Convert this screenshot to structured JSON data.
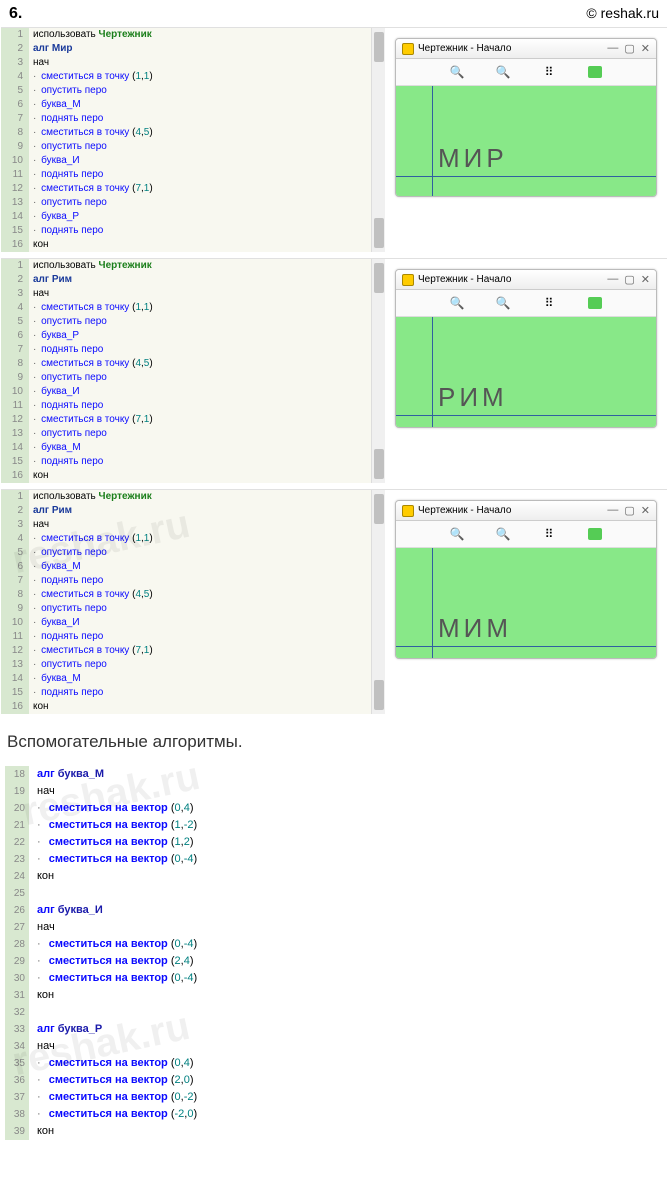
{
  "header": {
    "num": "6.",
    "site": "© reshak.ru"
  },
  "progs": [
    {
      "lines": [
        {
          "n": "1",
          "p": [
            {
              "t": "использовать ",
              "c": ""
            },
            {
              "t": "Чертежник",
              "c": "kw-lib"
            }
          ]
        },
        {
          "n": "2",
          "p": [
            {
              "t": "алг ",
              "c": "kw-alg"
            },
            {
              "t": "Мир",
              "c": "kw-nm"
            }
          ]
        },
        {
          "n": "3",
          "p": [
            {
              "t": "нач",
              "c": "kw-s"
            }
          ]
        },
        {
          "n": "4",
          "d": true,
          "p": [
            {
              "t": "сместиться в точку ",
              "c": "kw-cmd"
            },
            {
              "t": "(",
              "c": ""
            },
            {
              "t": "1",
              "c": "num"
            },
            {
              "t": ",",
              "c": ""
            },
            {
              "t": "1",
              "c": "num"
            },
            {
              "t": ")",
              "c": ""
            }
          ]
        },
        {
          "n": "5",
          "d": true,
          "p": [
            {
              "t": "опустить перо",
              "c": "kw-cmd"
            }
          ]
        },
        {
          "n": "6",
          "d": true,
          "p": [
            {
              "t": "буква_М",
              "c": "kw-cmd"
            }
          ]
        },
        {
          "n": "7",
          "d": true,
          "p": [
            {
              "t": "поднять перо",
              "c": "kw-cmd"
            }
          ]
        },
        {
          "n": "8",
          "d": true,
          "p": [
            {
              "t": "сместиться в точку ",
              "c": "kw-cmd"
            },
            {
              "t": "(",
              "c": ""
            },
            {
              "t": "4",
              "c": "num"
            },
            {
              "t": ",",
              "c": ""
            },
            {
              "t": "5",
              "c": "num"
            },
            {
              "t": ")",
              "c": ""
            }
          ]
        },
        {
          "n": "9",
          "d": true,
          "p": [
            {
              "t": "опустить перо",
              "c": "kw-cmd"
            }
          ]
        },
        {
          "n": "10",
          "d": true,
          "p": [
            {
              "t": "буква_И",
              "c": "kw-cmd"
            }
          ]
        },
        {
          "n": "11",
          "d": true,
          "p": [
            {
              "t": "поднять перо",
              "c": "kw-cmd"
            }
          ]
        },
        {
          "n": "12",
          "d": true,
          "p": [
            {
              "t": "сместиться в точку ",
              "c": "kw-cmd"
            },
            {
              "t": "(",
              "c": ""
            },
            {
              "t": "7",
              "c": "num"
            },
            {
              "t": ",",
              "c": ""
            },
            {
              "t": "1",
              "c": "num"
            },
            {
              "t": ")",
              "c": ""
            }
          ]
        },
        {
          "n": "13",
          "d": true,
          "p": [
            {
              "t": "опустить перо",
              "c": "kw-cmd"
            }
          ]
        },
        {
          "n": "14",
          "d": true,
          "p": [
            {
              "t": "буква_Р",
              "c": "kw-cmd"
            }
          ]
        },
        {
          "n": "15",
          "d": true,
          "p": [
            {
              "t": "поднять перо",
              "c": "kw-cmd"
            }
          ]
        },
        {
          "n": "16",
          "p": [
            {
              "t": "кон",
              "c": "kw-s"
            }
          ]
        }
      ],
      "out": {
        "title": "Чертежник - Начало",
        "word": "МИР",
        "ax_h": 90,
        "ax_v": 36
      }
    },
    {
      "lines": [
        {
          "n": "1",
          "p": [
            {
              "t": "использовать ",
              "c": ""
            },
            {
              "t": "Чертежник",
              "c": "kw-lib"
            }
          ]
        },
        {
          "n": "2",
          "p": [
            {
              "t": "алг ",
              "c": "kw-alg"
            },
            {
              "t": "Рим",
              "c": "kw-nm"
            }
          ]
        },
        {
          "n": "3",
          "p": [
            {
              "t": "нач",
              "c": "kw-s"
            }
          ]
        },
        {
          "n": "4",
          "d": true,
          "p": [
            {
              "t": "сместиться в точку ",
              "c": "kw-cmd"
            },
            {
              "t": "(",
              "c": ""
            },
            {
              "t": "1",
              "c": "num"
            },
            {
              "t": ",",
              "c": ""
            },
            {
              "t": "1",
              "c": "num"
            },
            {
              "t": ")",
              "c": ""
            }
          ]
        },
        {
          "n": "5",
          "d": true,
          "p": [
            {
              "t": "опустить перо",
              "c": "kw-cmd"
            }
          ]
        },
        {
          "n": "6",
          "d": true,
          "p": [
            {
              "t": "буква_Р",
              "c": "kw-cmd"
            }
          ]
        },
        {
          "n": "7",
          "d": true,
          "p": [
            {
              "t": "поднять перо",
              "c": "kw-cmd"
            }
          ]
        },
        {
          "n": "8",
          "d": true,
          "p": [
            {
              "t": "сместиться в точку ",
              "c": "kw-cmd"
            },
            {
              "t": "(",
              "c": ""
            },
            {
              "t": "4",
              "c": "num"
            },
            {
              "t": ",",
              "c": ""
            },
            {
              "t": "5",
              "c": "num"
            },
            {
              "t": ")",
              "c": ""
            }
          ]
        },
        {
          "n": "9",
          "d": true,
          "p": [
            {
              "t": "опустить перо",
              "c": "kw-cmd"
            }
          ]
        },
        {
          "n": "10",
          "d": true,
          "p": [
            {
              "t": "буква_И",
              "c": "kw-cmd"
            }
          ]
        },
        {
          "n": "11",
          "d": true,
          "p": [
            {
              "t": "поднять перо",
              "c": "kw-cmd"
            }
          ]
        },
        {
          "n": "12",
          "d": true,
          "p": [
            {
              "t": "сместиться в точку ",
              "c": "kw-cmd"
            },
            {
              "t": "(",
              "c": ""
            },
            {
              "t": "7",
              "c": "num"
            },
            {
              "t": ",",
              "c": ""
            },
            {
              "t": "1",
              "c": "num"
            },
            {
              "t": ")",
              "c": ""
            }
          ]
        },
        {
          "n": "13",
          "d": true,
          "p": [
            {
              "t": "опустить перо",
              "c": "kw-cmd"
            }
          ]
        },
        {
          "n": "14",
          "d": true,
          "p": [
            {
              "t": "буква_М",
              "c": "kw-cmd"
            }
          ]
        },
        {
          "n": "15",
          "d": true,
          "p": [
            {
              "t": "поднять перо",
              "c": "kw-cmd"
            }
          ]
        },
        {
          "n": "16",
          "p": [
            {
              "t": "кон",
              "c": "kw-s"
            }
          ]
        }
      ],
      "out": {
        "title": "Чертежник - Начало",
        "word": "РИМ",
        "ax_h": 98,
        "ax_v": 36
      }
    },
    {
      "lines": [
        {
          "n": "1",
          "p": [
            {
              "t": "использовать ",
              "c": ""
            },
            {
              "t": "Чертежник",
              "c": "kw-lib"
            }
          ]
        },
        {
          "n": "2",
          "p": [
            {
              "t": "алг ",
              "c": "kw-alg"
            },
            {
              "t": "Рим",
              "c": "kw-nm"
            }
          ]
        },
        {
          "n": "3",
          "p": [
            {
              "t": "нач",
              "c": "kw-s"
            }
          ]
        },
        {
          "n": "4",
          "d": true,
          "p": [
            {
              "t": "сместиться в точку ",
              "c": "kw-cmd"
            },
            {
              "t": "(",
              "c": ""
            },
            {
              "t": "1",
              "c": "num"
            },
            {
              "t": ",",
              "c": ""
            },
            {
              "t": "1",
              "c": "num"
            },
            {
              "t": ")",
              "c": ""
            }
          ]
        },
        {
          "n": "5",
          "d": true,
          "p": [
            {
              "t": "опустить перо",
              "c": "kw-cmd"
            }
          ]
        },
        {
          "n": "6",
          "d": true,
          "p": [
            {
              "t": "буква_М",
              "c": "kw-cmd"
            }
          ]
        },
        {
          "n": "7",
          "d": true,
          "p": [
            {
              "t": "поднять перо",
              "c": "kw-cmd"
            }
          ]
        },
        {
          "n": "8",
          "d": true,
          "p": [
            {
              "t": "сместиться в точку ",
              "c": "kw-cmd"
            },
            {
              "t": "(",
              "c": ""
            },
            {
              "t": "4",
              "c": "num"
            },
            {
              "t": ",",
              "c": ""
            },
            {
              "t": "5",
              "c": "num"
            },
            {
              "t": ")",
              "c": ""
            }
          ]
        },
        {
          "n": "9",
          "d": true,
          "p": [
            {
              "t": "опустить перо",
              "c": "kw-cmd"
            }
          ]
        },
        {
          "n": "10",
          "d": true,
          "p": [
            {
              "t": "буква_И",
              "c": "kw-cmd"
            }
          ]
        },
        {
          "n": "11",
          "d": true,
          "p": [
            {
              "t": "поднять перо",
              "c": "kw-cmd"
            }
          ]
        },
        {
          "n": "12",
          "d": true,
          "p": [
            {
              "t": "сместиться в точку ",
              "c": "kw-cmd"
            },
            {
              "t": "(",
              "c": ""
            },
            {
              "t": "7",
              "c": "num"
            },
            {
              "t": ",",
              "c": ""
            },
            {
              "t": "1",
              "c": "num"
            },
            {
              "t": ")",
              "c": ""
            }
          ]
        },
        {
          "n": "13",
          "d": true,
          "p": [
            {
              "t": "опустить перо",
              "c": "kw-cmd"
            }
          ]
        },
        {
          "n": "14",
          "d": true,
          "p": [
            {
              "t": "буква_М",
              "c": "kw-cmd"
            }
          ]
        },
        {
          "n": "15",
          "d": true,
          "p": [
            {
              "t": "поднять перо",
              "c": "kw-cmd"
            }
          ]
        },
        {
          "n": "16",
          "p": [
            {
              "t": "кон",
              "c": "kw-s"
            }
          ]
        }
      ],
      "out": {
        "title": "Чертежник - Начало",
        "word": "МИМ",
        "ax_h": 98,
        "ax_v": 36
      }
    }
  ],
  "subtitle": "Вспомогательные алгоритмы.",
  "aux": [
    {
      "n": "18",
      "p": [
        {
          "t": "алг ",
          "c": "kw-a"
        },
        {
          "t": "буква_М",
          "c": "kw-an"
        }
      ]
    },
    {
      "n": "19",
      "p": [
        {
          "t": "нач",
          "c": ""
        }
      ]
    },
    {
      "n": "20",
      "d": true,
      "p": [
        {
          "t": "сместиться на вектор ",
          "c": "kw-a"
        },
        {
          "t": "(",
          "c": ""
        },
        {
          "t": "0",
          "c": "num"
        },
        {
          "t": ",",
          "c": ""
        },
        {
          "t": "4",
          "c": "num"
        },
        {
          "t": ")",
          "c": ""
        }
      ]
    },
    {
      "n": "21",
      "d": true,
      "p": [
        {
          "t": "сместиться на вектор ",
          "c": "kw-a"
        },
        {
          "t": "(",
          "c": ""
        },
        {
          "t": "1",
          "c": "num"
        },
        {
          "t": ",",
          "c": ""
        },
        {
          "t": "-2",
          "c": "num"
        },
        {
          "t": ")",
          "c": ""
        }
      ]
    },
    {
      "n": "22",
      "d": true,
      "p": [
        {
          "t": "сместиться на вектор ",
          "c": "kw-a"
        },
        {
          "t": "(",
          "c": ""
        },
        {
          "t": "1",
          "c": "num"
        },
        {
          "t": ",",
          "c": ""
        },
        {
          "t": "2",
          "c": "num"
        },
        {
          "t": ")",
          "c": ""
        }
      ]
    },
    {
      "n": "23",
      "d": true,
      "p": [
        {
          "t": "сместиться на вектор ",
          "c": "kw-a"
        },
        {
          "t": "(",
          "c": ""
        },
        {
          "t": "0",
          "c": "num"
        },
        {
          "t": ",",
          "c": ""
        },
        {
          "t": "-4",
          "c": "num"
        },
        {
          "t": ")",
          "c": ""
        }
      ]
    },
    {
      "n": "24",
      "p": [
        {
          "t": "кон",
          "c": ""
        }
      ]
    },
    {
      "n": "25",
      "p": [
        {
          "t": "",
          "c": ""
        }
      ]
    },
    {
      "n": "26",
      "p": [
        {
          "t": "алг ",
          "c": "kw-a"
        },
        {
          "t": "буква_И",
          "c": "kw-an"
        }
      ]
    },
    {
      "n": "27",
      "p": [
        {
          "t": "нач",
          "c": ""
        }
      ]
    },
    {
      "n": "28",
      "d": true,
      "p": [
        {
          "t": "сместиться на вектор ",
          "c": "kw-a"
        },
        {
          "t": "(",
          "c": ""
        },
        {
          "t": "0",
          "c": "num"
        },
        {
          "t": ",",
          "c": ""
        },
        {
          "t": "-4",
          "c": "num"
        },
        {
          "t": ")",
          "c": ""
        }
      ]
    },
    {
      "n": "29",
      "d": true,
      "p": [
        {
          "t": "сместиться на вектор ",
          "c": "kw-a"
        },
        {
          "t": "(",
          "c": ""
        },
        {
          "t": "2",
          "c": "num"
        },
        {
          "t": ",",
          "c": ""
        },
        {
          "t": "4",
          "c": "num"
        },
        {
          "t": ")",
          "c": ""
        }
      ]
    },
    {
      "n": "30",
      "d": true,
      "p": [
        {
          "t": "сместиться на вектор ",
          "c": "kw-a"
        },
        {
          "t": "(",
          "c": ""
        },
        {
          "t": "0",
          "c": "num"
        },
        {
          "t": ",",
          "c": ""
        },
        {
          "t": "-4",
          "c": "num"
        },
        {
          "t": ")",
          "c": ""
        }
      ]
    },
    {
      "n": "31",
      "p": [
        {
          "t": "кон",
          "c": ""
        }
      ]
    },
    {
      "n": "32",
      "p": [
        {
          "t": "",
          "c": ""
        }
      ]
    },
    {
      "n": "33",
      "p": [
        {
          "t": "алг ",
          "c": "kw-a"
        },
        {
          "t": "буква_Р",
          "c": "kw-an"
        }
      ]
    },
    {
      "n": "34",
      "p": [
        {
          "t": "нач",
          "c": ""
        }
      ]
    },
    {
      "n": "35",
      "d": true,
      "p": [
        {
          "t": "сместиться на вектор ",
          "c": "kw-a"
        },
        {
          "t": "(",
          "c": ""
        },
        {
          "t": "0",
          "c": "num"
        },
        {
          "t": ",",
          "c": ""
        },
        {
          "t": "4",
          "c": "num"
        },
        {
          "t": ")",
          "c": ""
        }
      ]
    },
    {
      "n": "36",
      "d": true,
      "p": [
        {
          "t": "сместиться на вектор ",
          "c": "kw-a"
        },
        {
          "t": "(",
          "c": ""
        },
        {
          "t": "2",
          "c": "num"
        },
        {
          "t": ",",
          "c": ""
        },
        {
          "t": "0",
          "c": "num"
        },
        {
          "t": ")",
          "c": ""
        }
      ]
    },
    {
      "n": "37",
      "d": true,
      "p": [
        {
          "t": "сместиться на вектор ",
          "c": "kw-a"
        },
        {
          "t": "(",
          "c": ""
        },
        {
          "t": "0",
          "c": "num"
        },
        {
          "t": ",",
          "c": ""
        },
        {
          "t": "-2",
          "c": "num"
        },
        {
          "t": ")",
          "c": ""
        }
      ]
    },
    {
      "n": "38",
      "d": true,
      "p": [
        {
          "t": "сместиться на вектор ",
          "c": "kw-a"
        },
        {
          "t": "(",
          "c": ""
        },
        {
          "t": "-2",
          "c": "num"
        },
        {
          "t": ",",
          "c": ""
        },
        {
          "t": "0",
          "c": "num"
        },
        {
          "t": ")",
          "c": ""
        }
      ]
    },
    {
      "n": "39",
      "p": [
        {
          "t": "кон",
          "c": ""
        }
      ]
    }
  ],
  "win_ctrl": {
    "min": "—",
    "max": "▢",
    "close": "✕"
  },
  "tb_icons": {
    "zin": "🔍",
    "zout": "🔍",
    "grid": "⠿",
    "green": ""
  },
  "wm": "reshak.ru"
}
